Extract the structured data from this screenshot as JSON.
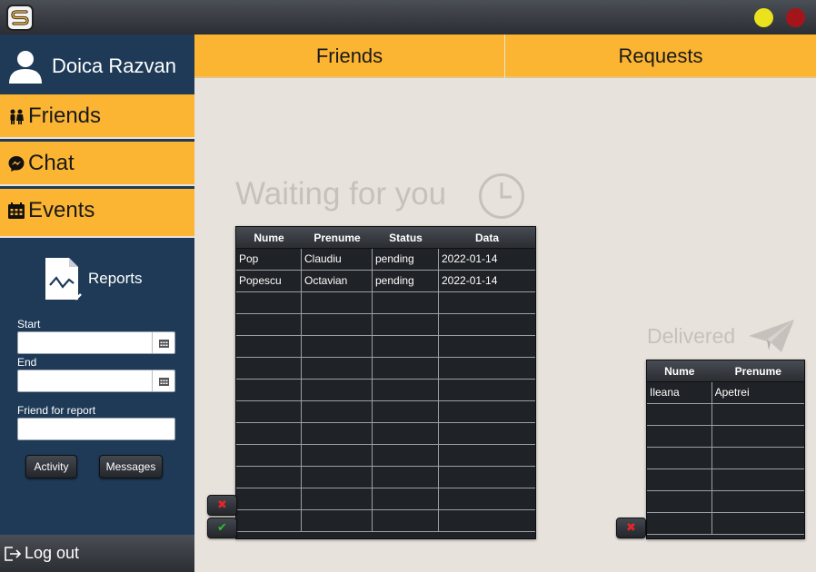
{
  "titlebar": {
    "logo_icon": "app-logo-s",
    "min_color": "#e9e21c",
    "close_color": "#a4151b"
  },
  "user": {
    "name": "Doica Razvan",
    "icon": "user-icon"
  },
  "sidebar": {
    "items": [
      {
        "label": "Friends",
        "icon": "people-icon"
      },
      {
        "label": "Chat",
        "icon": "messenger-icon"
      },
      {
        "label": "Events",
        "icon": "calendar-icon"
      }
    ],
    "reports": {
      "label": "Reports",
      "start_label": "Start",
      "start_value": "",
      "end_label": "End",
      "end_value": "",
      "friend_label": "Friend for report",
      "friend_value": "",
      "activity_button": "Activity",
      "messages_button": "Messages"
    },
    "logout": "Log out"
  },
  "tabs": [
    {
      "label": "Friends"
    },
    {
      "label": "Requests"
    }
  ],
  "accent_color": "#fbb532",
  "sidebar_color": "#1e3a57",
  "waiting": {
    "title": "Waiting for you",
    "columns": [
      "Nume",
      "Prenume",
      "Status",
      "Data"
    ],
    "rows": [
      [
        "Pop",
        "Claudiu",
        "pending",
        "2022-01-14"
      ],
      [
        "Popescu",
        "Octavian",
        "pending",
        "2022-01-14"
      ]
    ],
    "empty_rows": 11
  },
  "delivered": {
    "title": "Delivered",
    "columns": [
      "Nume",
      "Prenume"
    ],
    "rows": [
      [
        "Ileana",
        "Apetrei"
      ]
    ],
    "empty_rows": 6
  },
  "buttons": {
    "reject_glyph": "✖",
    "accept_glyph": "✔"
  }
}
